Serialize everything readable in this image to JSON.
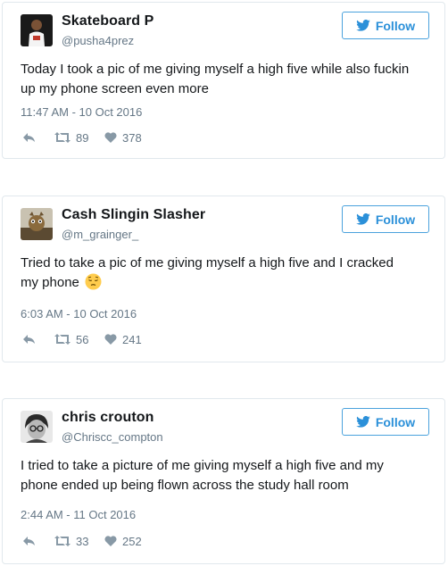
{
  "tweets": [
    {
      "display_name": "Skateboard P",
      "handle": "@pusha4prez",
      "follow_label": "Follow",
      "text": "Today I took a pic of me giving myself a high five while also fuckin up my phone screen even more",
      "timestamp": "11:47 AM - 10 Oct 2016",
      "retweets": "89",
      "likes": "378"
    },
    {
      "display_name": "Cash Slingin Slasher",
      "handle": "@m_grainger_",
      "follow_label": "Follow",
      "text": "Tried to take a pic of me giving myself a high five and I cracked my phone",
      "emoji": "pensive-face-emoji",
      "timestamp": "6:03 AM - 10 Oct 2016",
      "retweets": "56",
      "likes": "241"
    },
    {
      "display_name": "chris crouton",
      "handle": "@Chriscc_compton",
      "follow_label": "Follow",
      "text": "I tried to take a picture of me giving myself a high five and my phone ended up being flown across the study hall room",
      "timestamp": "2:44 AM - 11 Oct 2016",
      "retweets": "33",
      "likes": "252"
    }
  ],
  "colors": {
    "accent": "#2b90d9",
    "follow_border": "#4aa2dd",
    "text": "#14171a",
    "secondary": "#657786",
    "card_border": "#e1e8ed"
  }
}
